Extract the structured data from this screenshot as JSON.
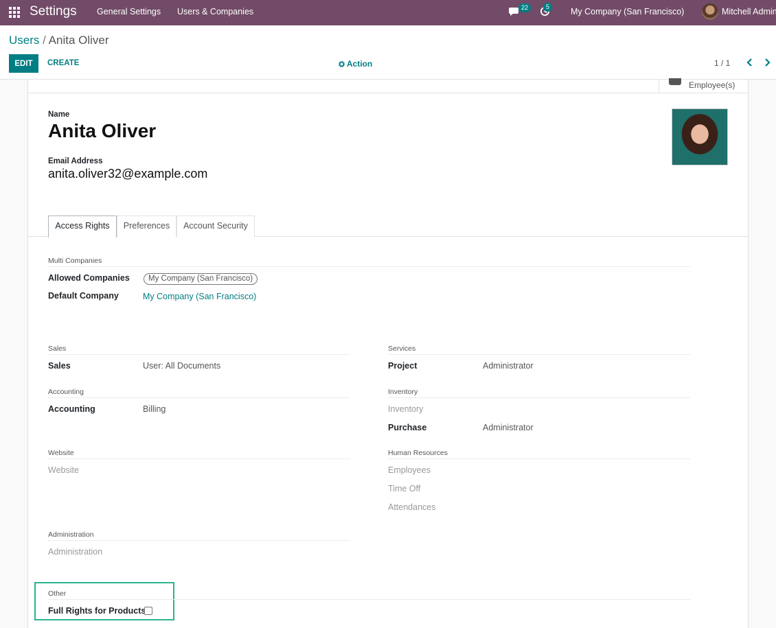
{
  "topnav": {
    "app_title": "Settings",
    "menu": [
      "General Settings",
      "Users & Companies"
    ],
    "messages_badge": "22",
    "activities_badge": "5",
    "company": "My Company (San Francisco)",
    "user": "Mitchell Admin"
  },
  "control": {
    "breadcrumb_parent": "Users",
    "breadcrumb_sep": "/",
    "breadcrumb_current": "Anita Oliver",
    "edit_label": "EDIT",
    "create_label": "CREATE",
    "action_label": "Action",
    "pager": "1 / 1"
  },
  "smart_button": {
    "label": "Employee(s)"
  },
  "header": {
    "name_label": "Name",
    "name": "Anita Oliver",
    "email_label": "Email Address",
    "email": "anita.oliver32@example.com"
  },
  "tabs": [
    "Access Rights",
    "Preferences",
    "Account Security"
  ],
  "multi_companies": {
    "title": "Multi Companies",
    "allowed_label": "Allowed Companies",
    "allowed_tag": "My Company (San Francisco)",
    "default_label": "Default Company",
    "default_value": "My Company (San Francisco)"
  },
  "groups": {
    "sales": {
      "title": "Sales",
      "label": "Sales",
      "value": "User: All Documents"
    },
    "services": {
      "title": "Services",
      "label": "Project",
      "value": "Administrator"
    },
    "accounting": {
      "title": "Accounting",
      "label": "Accounting",
      "value": "Billing"
    },
    "inventory": {
      "title": "Inventory",
      "label1": "Inventory",
      "label2": "Purchase",
      "value2": "Administrator"
    },
    "website": {
      "title": "Website",
      "label": "Website"
    },
    "hr": {
      "title": "Human Resources",
      "items": [
        "Employees",
        "Time Off",
        "Attendances"
      ]
    },
    "administration": {
      "title": "Administration",
      "label": "Administration"
    },
    "other": {
      "title": "Other",
      "label": "Full Rights for Products",
      "checked": false
    }
  },
  "colors": {
    "navbar": "#714b67",
    "accent": "#017e84",
    "highlight": "#28b48c"
  }
}
